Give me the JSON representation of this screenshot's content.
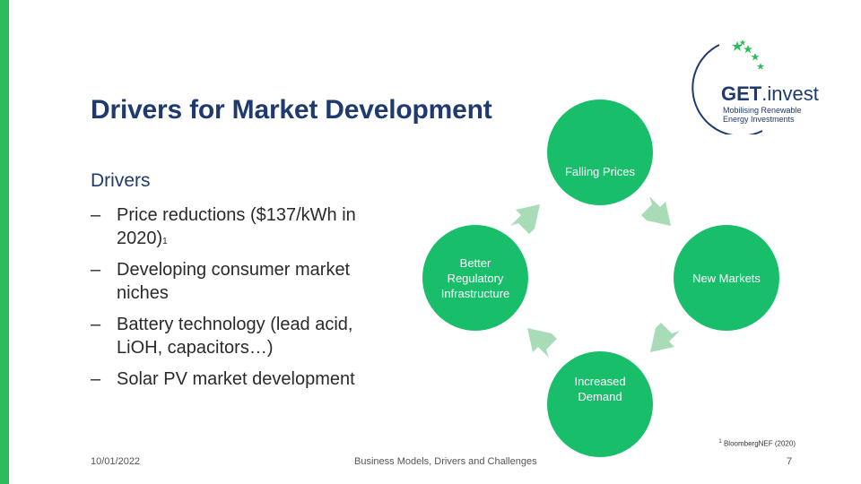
{
  "slide": {
    "title": "Drivers for Market Development",
    "subheading": "Drivers",
    "bullets": [
      {
        "text": "Price reductions ($137/kWh in 2020)",
        "sup": "1"
      },
      {
        "text": "Developing consumer market niches",
        "sup": ""
      },
      {
        "text": "Battery technology (lead acid, LiOH, capacitors…)",
        "sup": ""
      },
      {
        "text": "Solar PV market development",
        "sup": ""
      }
    ],
    "bullet_marker": "–"
  },
  "cycle": {
    "top": "Falling Prices",
    "right": "New Markets",
    "bottom": "Increased Demand",
    "left": "Better Regulatory Infrastructure"
  },
  "logo": {
    "brand_main": "GET",
    "brand_suffix": ".invest",
    "tagline_line1": "Mobilising Renewable",
    "tagline_line2": "Energy Investments"
  },
  "footer": {
    "date": "10/01/2022",
    "center": "Business Models, Drivers and Challenges",
    "page": "7",
    "footnote_mark": "1",
    "footnote_text": "BloombergNEF (2020)"
  },
  "colors": {
    "accent_green": "#19be6b",
    "bar_green": "#2bbd5c",
    "arrow_green": "#a8dcb6",
    "title_navy": "#1f3a6e"
  }
}
